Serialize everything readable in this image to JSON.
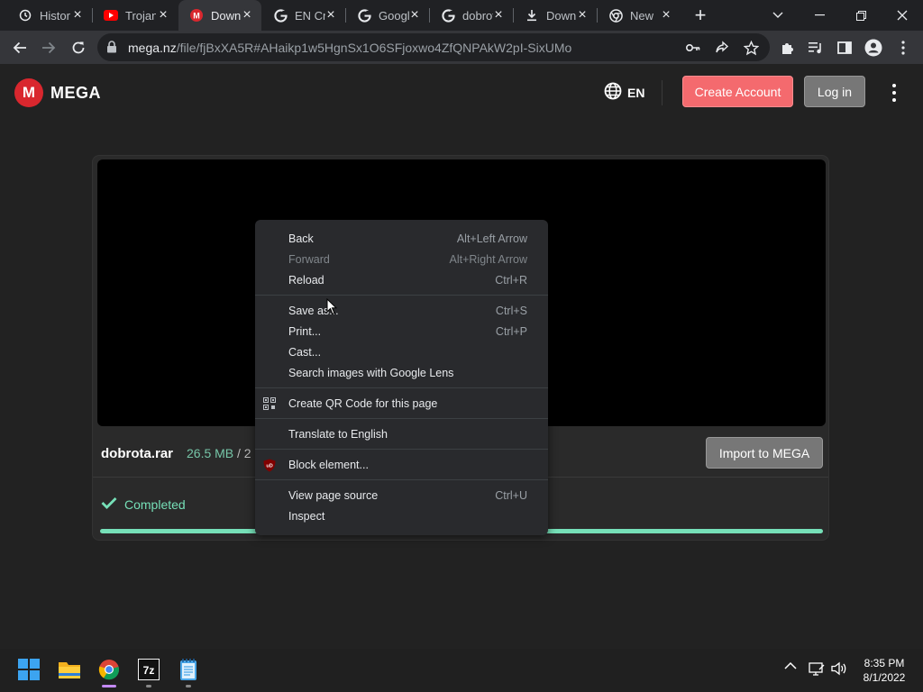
{
  "tabs": [
    {
      "title": "History",
      "icon": "history-icon",
      "active": false
    },
    {
      "title": "Trojan",
      "icon": "youtube-icon",
      "active": false
    },
    {
      "title": "Download",
      "icon": "mega-icon",
      "active": true
    },
    {
      "title": "EN Cr",
      "icon": "google-icon",
      "active": false
    },
    {
      "title": "Google",
      "icon": "google-icon",
      "active": false
    },
    {
      "title": "dobrota",
      "icon": "google-icon",
      "active": false
    },
    {
      "title": "Download",
      "icon": "download-icon",
      "active": false
    },
    {
      "title": "New",
      "icon": "chrome-icon",
      "active": false
    }
  ],
  "omnibox": {
    "domain": "mega.nz",
    "path": "/file/fjBxXA5R#AHaikp1w5HgnSx1O6SFjoxwo4ZfQNPAkW2pI-SixUMo"
  },
  "header": {
    "logo_letter": "M",
    "logo_text": "MEGA",
    "language": "EN",
    "create_account": "Create Account",
    "login": "Log in"
  },
  "file": {
    "name": "dobrota.rar",
    "size": "26.5 MB",
    "size_sep": " / 2",
    "import_label": "Import to MEGA",
    "status": "Completed",
    "progress": 1.0
  },
  "context_menu": {
    "groups": [
      [
        {
          "label": "Back",
          "shortcut": "Alt+Left Arrow",
          "disabled": false
        },
        {
          "label": "Forward",
          "shortcut": "Alt+Right Arrow",
          "disabled": true
        },
        {
          "label": "Reload",
          "shortcut": "Ctrl+R",
          "disabled": false
        }
      ],
      [
        {
          "label": "Save as...",
          "shortcut": "Ctrl+S",
          "disabled": false
        },
        {
          "label": "Print...",
          "shortcut": "Ctrl+P",
          "disabled": false
        },
        {
          "label": "Cast...",
          "shortcut": "",
          "disabled": false
        },
        {
          "label": "Search images with Google Lens",
          "shortcut": "",
          "disabled": false
        }
      ],
      [
        {
          "label": "Create QR Code for this page",
          "shortcut": "",
          "disabled": false,
          "icon": "qr-code-icon"
        }
      ],
      [
        {
          "label": "Translate to English",
          "shortcut": "",
          "disabled": false
        }
      ],
      [
        {
          "label": "Block element...",
          "shortcut": "",
          "disabled": false,
          "icon": "ublock-icon"
        }
      ],
      [
        {
          "label": "View page source",
          "shortcut": "Ctrl+U",
          "disabled": false
        },
        {
          "label": "Inspect",
          "shortcut": "",
          "disabled": false
        }
      ]
    ]
  },
  "clock": {
    "time": "8:35 PM",
    "date": "8/1/2022"
  },
  "colors": {
    "mega_red": "#d9272e",
    "create_btn": "#f46a6e",
    "success_green": "#76e0b8"
  }
}
